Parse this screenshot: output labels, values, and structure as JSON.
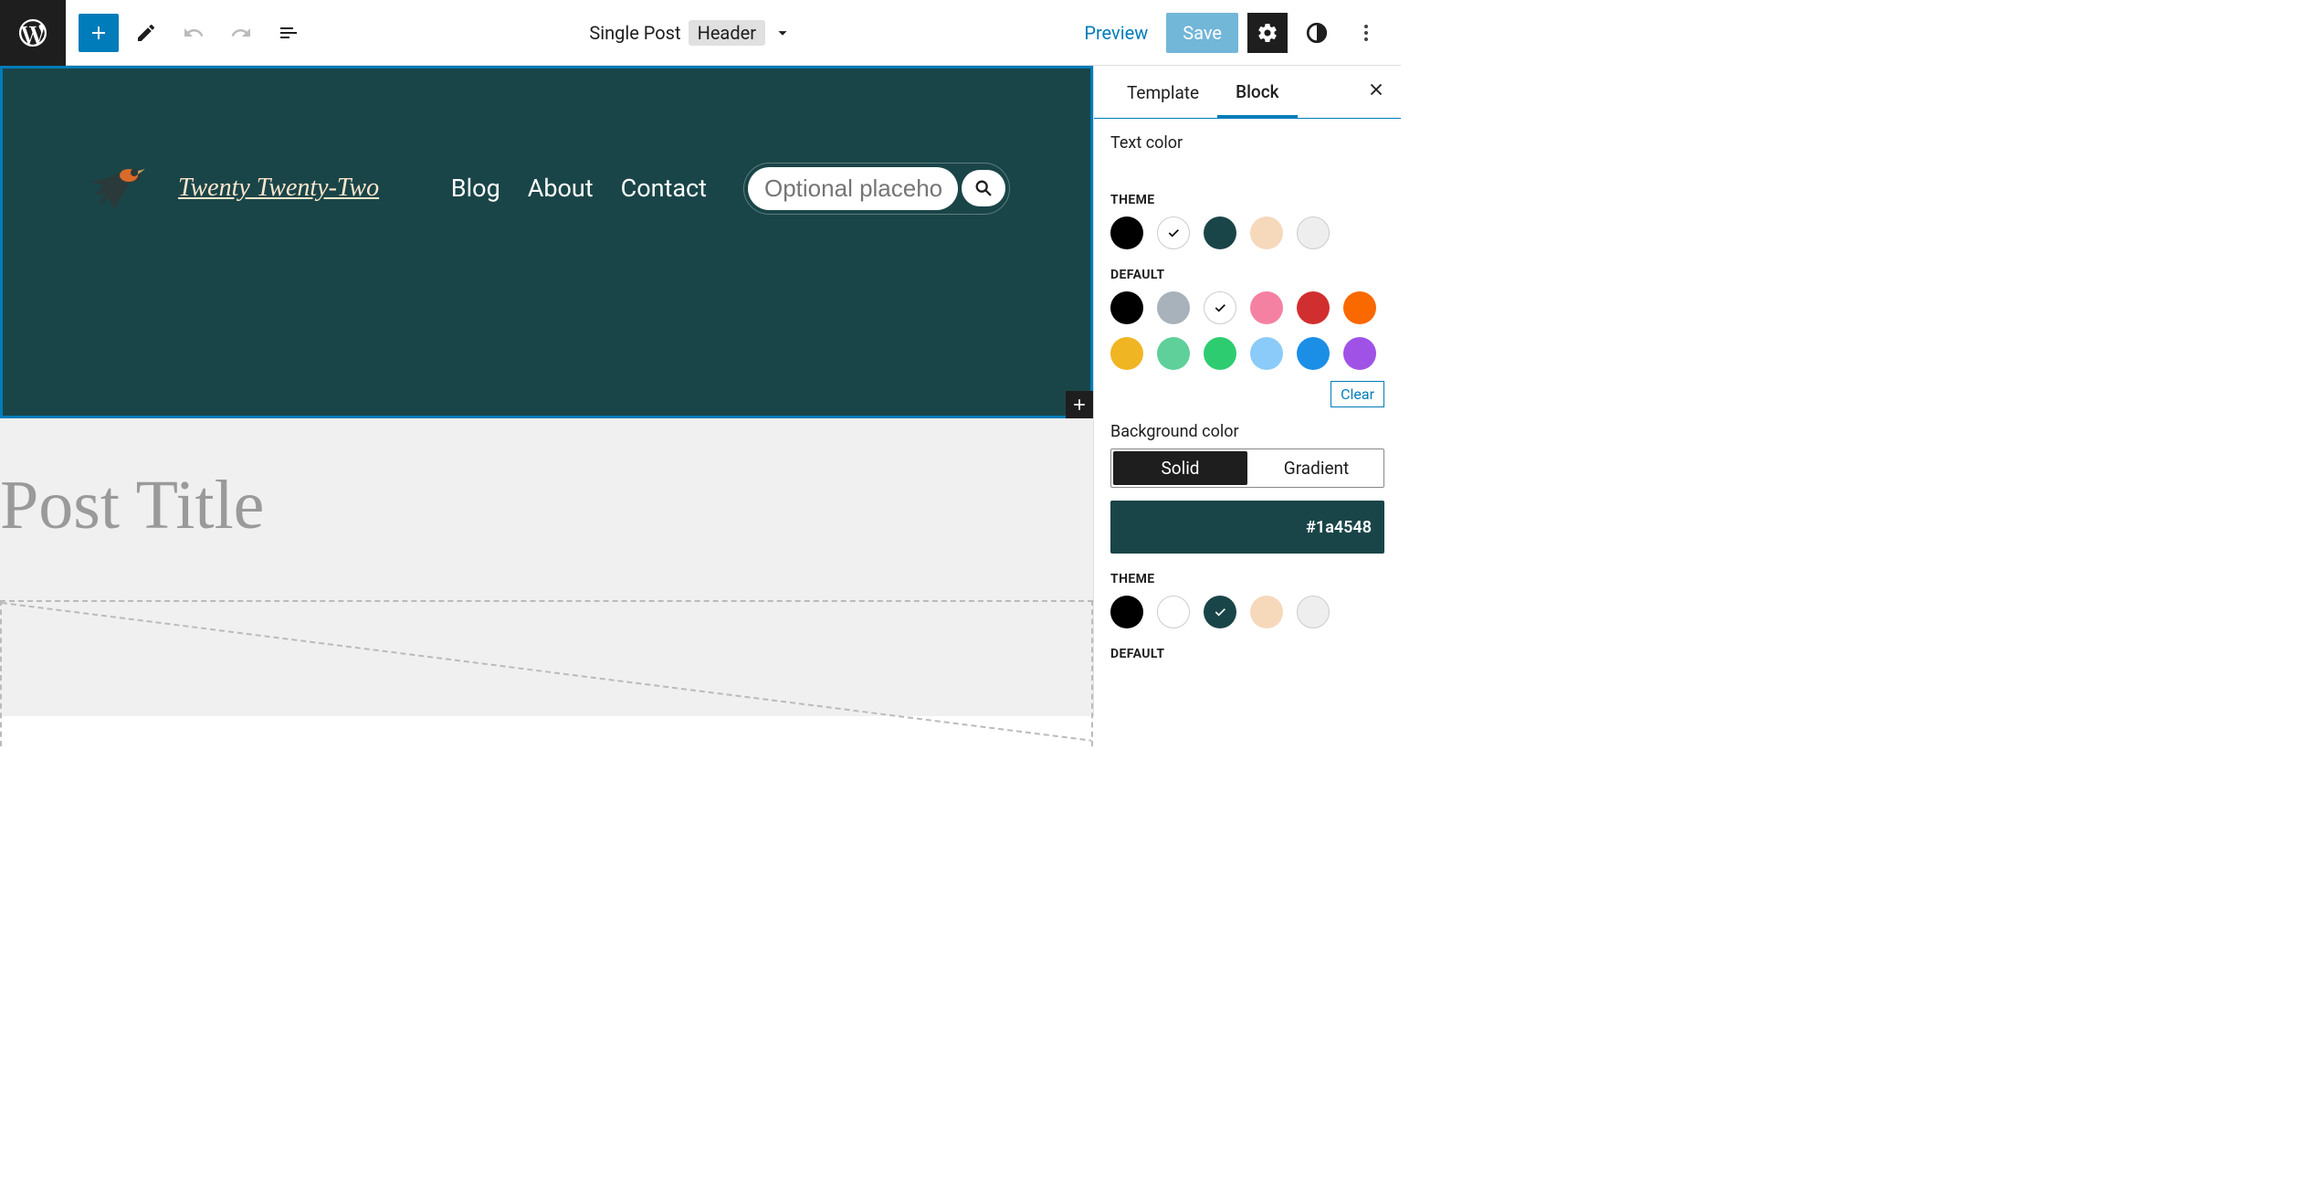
{
  "topbar": {
    "doc_type": "Single Post",
    "part": "Header",
    "preview": "Preview",
    "save": "Save"
  },
  "header_block": {
    "site_title": "Twenty Twenty-Two",
    "nav": [
      "Blog",
      "About",
      "Contact"
    ],
    "search_placeholder": "Optional placeholder…"
  },
  "canvas": {
    "post_title_placeholder": "Post Title"
  },
  "sidebar": {
    "tabs": {
      "template": "Template",
      "block": "Block"
    },
    "text_color": {
      "label": "Text color",
      "theme_label": "THEME",
      "theme_swatches": [
        {
          "color": "#000000",
          "selected": false
        },
        {
          "color": "#ffffff",
          "selected": true,
          "border": true,
          "check": "black"
        },
        {
          "color": "#1a4548",
          "selected": false
        },
        {
          "color": "#f6d8bb",
          "selected": false
        },
        {
          "color": "#eeeeee",
          "selected": false,
          "border": true
        }
      ],
      "default_label": "DEFAULT",
      "default_swatches_r1": [
        {
          "color": "#000000",
          "selected": false
        },
        {
          "color": "#a8b2bb",
          "selected": false
        },
        {
          "color": "#ffffff",
          "selected": true,
          "border": true,
          "check": "black"
        },
        {
          "color": "#f481a2",
          "selected": false
        },
        {
          "color": "#d12f2f",
          "selected": false
        },
        {
          "color": "#fa6800",
          "selected": false
        }
      ],
      "default_swatches_r2": [
        {
          "color": "#f0b523",
          "selected": false
        },
        {
          "color": "#5fd09a",
          "selected": false
        },
        {
          "color": "#2ecc71",
          "selected": false
        },
        {
          "color": "#8bcbf9",
          "selected": false
        },
        {
          "color": "#1b8ee6",
          "selected": false
        },
        {
          "color": "#a052e6",
          "selected": false
        }
      ],
      "clear": "Clear"
    },
    "background_color": {
      "label": "Background color",
      "mode_solid": "Solid",
      "mode_gradient": "Gradient",
      "hex": "#1a4548",
      "theme_label": "THEME",
      "theme_swatches": [
        {
          "color": "#000000",
          "selected": false
        },
        {
          "color": "#ffffff",
          "selected": false,
          "border": true
        },
        {
          "color": "#1a4548",
          "selected": true,
          "check": "white"
        },
        {
          "color": "#f6d8bb",
          "selected": false
        },
        {
          "color": "#eeeeee",
          "selected": false,
          "border": true
        }
      ],
      "default_label": "DEFAULT"
    }
  }
}
